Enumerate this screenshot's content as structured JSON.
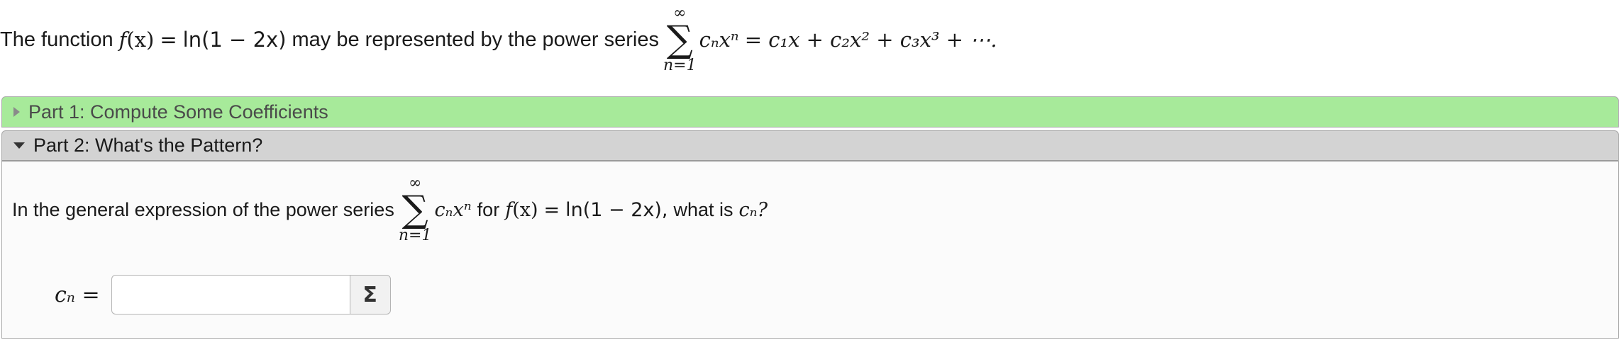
{
  "intro": {
    "text_before": "The function",
    "function_name": "f",
    "function_arg": "(x)",
    "equals": "=",
    "function_expr": "ln(1 − 2x)",
    "text_middle": "may be represented by the power series",
    "sum_upper": "∞",
    "sum_symbol": "∑",
    "sum_lower": "n=1",
    "series_general": "cₙxⁿ",
    "series_expansion": "= c₁x + c₂x² + c₃x³ + ⋯."
  },
  "parts": [
    {
      "label": "Part 1: Compute Some Coefficients",
      "state": "collapsed",
      "status_color": "#a7ea9a"
    },
    {
      "label": "Part 2: What's the Pattern?",
      "state": "expanded",
      "status_color": "#d3d3d3"
    }
  ],
  "question": {
    "text_before": "In the general expression of the power series",
    "sum_upper": "∞",
    "sum_symbol": "∑",
    "sum_lower": "n=1",
    "series_general": "cₙxⁿ",
    "text_for": "for",
    "function_name": "f",
    "function_arg": "(x)",
    "equals": "=",
    "function_expr": "ln(1 − 2x),",
    "text_after": "what is",
    "target": "cₙ?"
  },
  "answer": {
    "label": "cₙ =",
    "value": "",
    "placeholder": "",
    "equation_button": "Σ"
  },
  "icons": {
    "part1_caret": "caret-right-icon",
    "part2_caret": "caret-down-icon",
    "equation_editor": "sigma-icon"
  }
}
